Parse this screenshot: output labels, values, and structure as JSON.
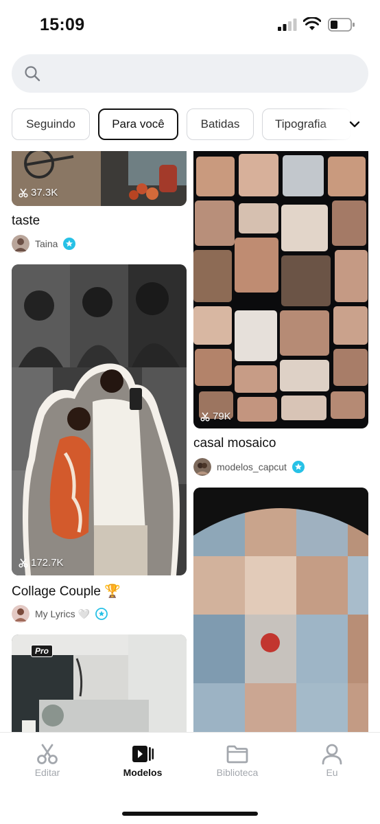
{
  "status_bar": {
    "time": "15:09"
  },
  "search": {
    "placeholder": ""
  },
  "chips": [
    {
      "label": "Seguindo"
    },
    {
      "label": "Para você"
    },
    {
      "label": "Batidas"
    },
    {
      "label": "Tipografia"
    }
  ],
  "feed": {
    "left": [
      {
        "title": "taste",
        "uses": "37.3K",
        "author": "Taina"
      },
      {
        "title": "Collage Couple 🏆",
        "uses": "172.7K",
        "author": "My Lyrics 🤍"
      },
      {
        "badge": "Pro"
      }
    ],
    "right": [
      {
        "title": "casal mosaico",
        "uses": "79K",
        "author": "modelos_capcut"
      },
      {
        "title": "",
        "uses": ""
      }
    ]
  },
  "tabs": [
    {
      "label": "Editar",
      "icon": "scissors-icon"
    },
    {
      "label": "Modelos",
      "icon": "templates-icon"
    },
    {
      "label": "Biblioteca",
      "icon": "folder-icon"
    },
    {
      "label": "Eu",
      "icon": "person-icon"
    }
  ],
  "colors": {
    "accent": "#111111",
    "inactive": "#a3a7ad",
    "verified": "#27c1e6",
    "search_bg": "#eef0f3"
  }
}
